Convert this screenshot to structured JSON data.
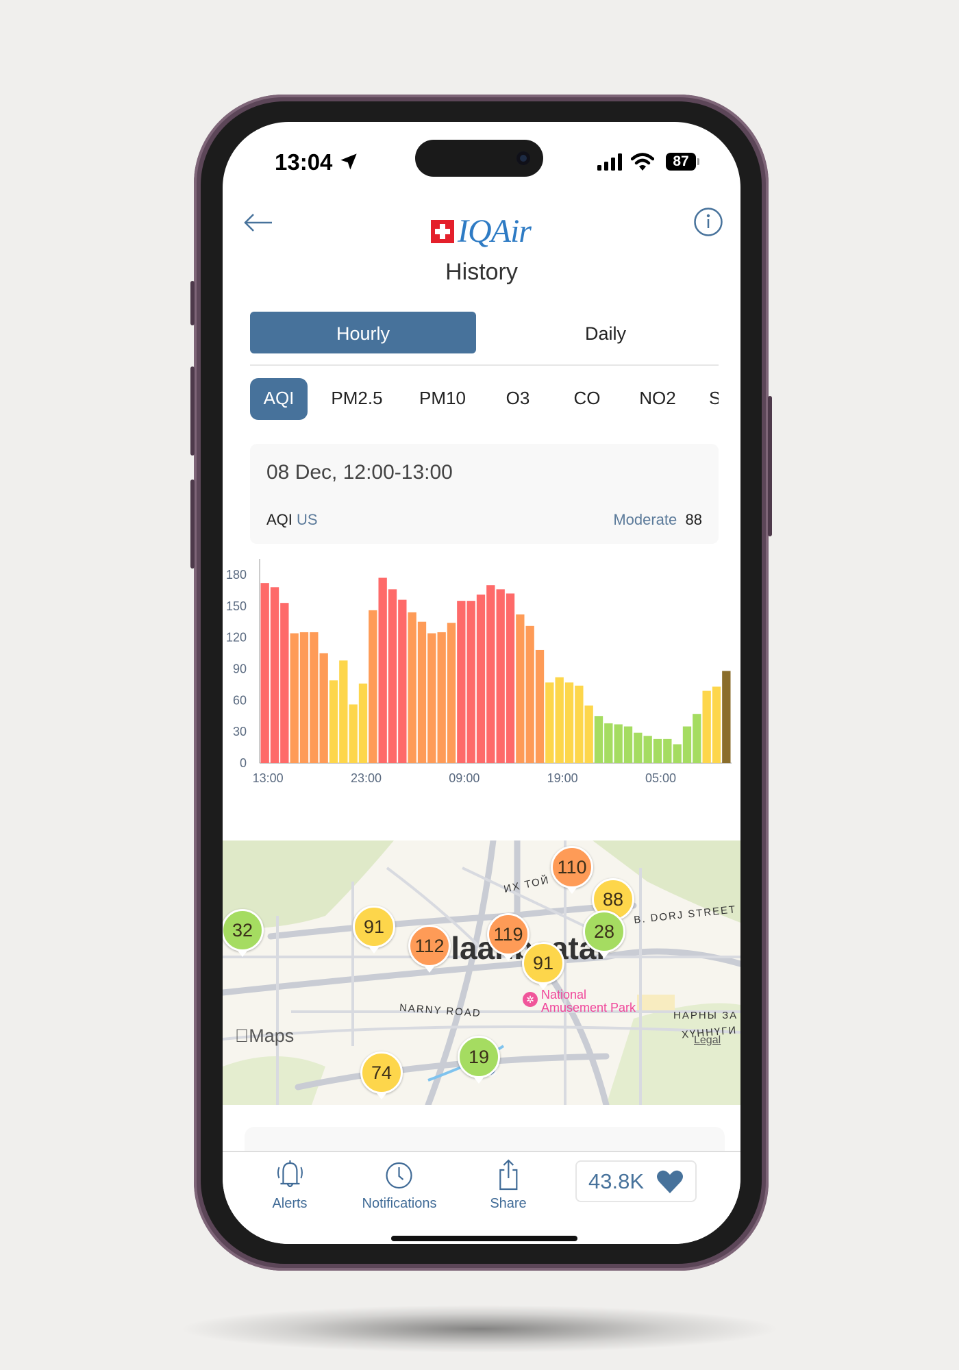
{
  "status_bar": {
    "time": "13:04",
    "battery": "87"
  },
  "header": {
    "logo_text": "IQAir",
    "title": "History"
  },
  "period_tabs": [
    {
      "label": "Hourly",
      "active": true
    },
    {
      "label": "Daily",
      "active": false
    }
  ],
  "pollutant_tabs": [
    {
      "label": "AQI",
      "active": true
    },
    {
      "label": "PM2.5"
    },
    {
      "label": "PM10"
    },
    {
      "label": "O3"
    },
    {
      "label": "CO"
    },
    {
      "label": "NO2"
    },
    {
      "label": "S"
    }
  ],
  "selection_card": {
    "datetime": "08 Dec, 12:00-13:00",
    "metric": "AQI",
    "unit": "US",
    "level": "Moderate",
    "value": "88"
  },
  "colors": {
    "accent": "#47729b",
    "unhealthy": "#fe6a69",
    "sensitive": "#fe9b57",
    "moderate": "#fdd64b",
    "good": "#a5dc61",
    "selected": "#8a6d2b"
  },
  "chart_data": {
    "type": "bar",
    "ylim": [
      0,
      195
    ],
    "yticks": [
      "0",
      "30",
      "60",
      "90",
      "120",
      "150",
      "180"
    ],
    "xtick_labels": [
      {
        "label": "13:00",
        "index": 0
      },
      {
        "label": "23:00",
        "index": 10
      },
      {
        "label": "09:00",
        "index": 20
      },
      {
        "label": "19:00",
        "index": 30
      },
      {
        "label": "05:00",
        "index": 40
      }
    ],
    "values": [
      172,
      168,
      153,
      124,
      125,
      125,
      105,
      79,
      98,
      56,
      76,
      146,
      177,
      166,
      156,
      144,
      135,
      124,
      125,
      134,
      155,
      155,
      161,
      170,
      166,
      162,
      142,
      131,
      108,
      77,
      82,
      77,
      74,
      55,
      45,
      38,
      37,
      35,
      29,
      26,
      23,
      23,
      18,
      35,
      47,
      69,
      73,
      88
    ],
    "selected_index": 47,
    "grid": false
  },
  "map": {
    "markers": [
      {
        "value": "32",
        "level": "good"
      },
      {
        "value": "91",
        "level": "moderate"
      },
      {
        "value": "112",
        "level": "sensitive"
      },
      {
        "value": "119",
        "level": "sensitive"
      },
      {
        "value": "110",
        "level": "sensitive"
      },
      {
        "value": "88",
        "level": "moderate"
      },
      {
        "value": "28",
        "level": "good"
      },
      {
        "value": "91",
        "level": "moderate"
      },
      {
        "value": "19",
        "level": "good"
      },
      {
        "value": "74",
        "level": "moderate"
      }
    ],
    "labels": {
      "city": "Ulaanbaatar",
      "road1": "ИХ ТОЙ",
      "road2": "B. DORJ STREET",
      "road3": "NARNY ROAD",
      "road4": "НАРНЫ ЗА",
      "road5": "ХҮННҮГИ",
      "poi": "National\nAmusement Park",
      "attribution": "Maps",
      "legal": "Legal"
    }
  },
  "tabbar": {
    "items": [
      {
        "label": "Alerts",
        "icon": "bell-icon"
      },
      {
        "label": "Notifications",
        "icon": "clock-icon"
      },
      {
        "label": "Share",
        "icon": "share-icon"
      }
    ],
    "likes": "43.8K"
  }
}
